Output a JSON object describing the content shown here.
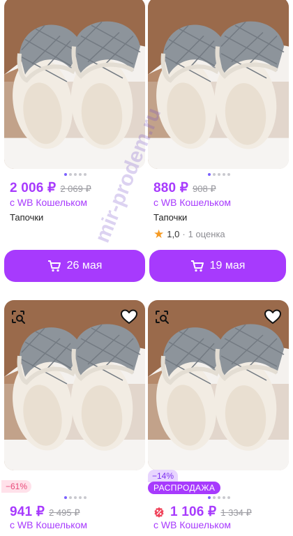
{
  "products": [
    {
      "price": "2 006 ₽",
      "old_price": "2 069 ₽",
      "wallet_text": "с WB Кошельком",
      "name": "Тапочки",
      "delivery_label": "26 мая"
    },
    {
      "price": "880 ₽",
      "old_price": "908 ₽",
      "wallet_text": "с WB Кошельком",
      "name": "Тапочки",
      "rating": "1,0",
      "rating_separator": "·",
      "reviews": "1 оценка",
      "delivery_label": "19 мая"
    },
    {
      "discount_badge": "−61%",
      "price": "941 ₽",
      "old_price": "2 495 ₽",
      "wallet_text": "с WB Кошельком"
    },
    {
      "discount_badge": "−14%",
      "sale_badge": "РАСПРОДАЖА",
      "price": "1 106 ₽",
      "old_price": "1 334 ₽",
      "wallet_text": "с WB Кошельком"
    }
  ],
  "watermark": "mir-prodem.ru",
  "icons": {
    "cart": "cart-icon",
    "similar_search": "similar-search-icon",
    "favorite": "heart-icon",
    "rating_star": "star-icon",
    "sale": "sale-tag-icon"
  },
  "colors": {
    "accent": "#a73afd",
    "star": "#f59a23",
    "discount_pink_bg": "#ffe1ea",
    "discount_pink_text": "#e84a7a",
    "discount_lilac_bg": "#e8d5ff"
  }
}
